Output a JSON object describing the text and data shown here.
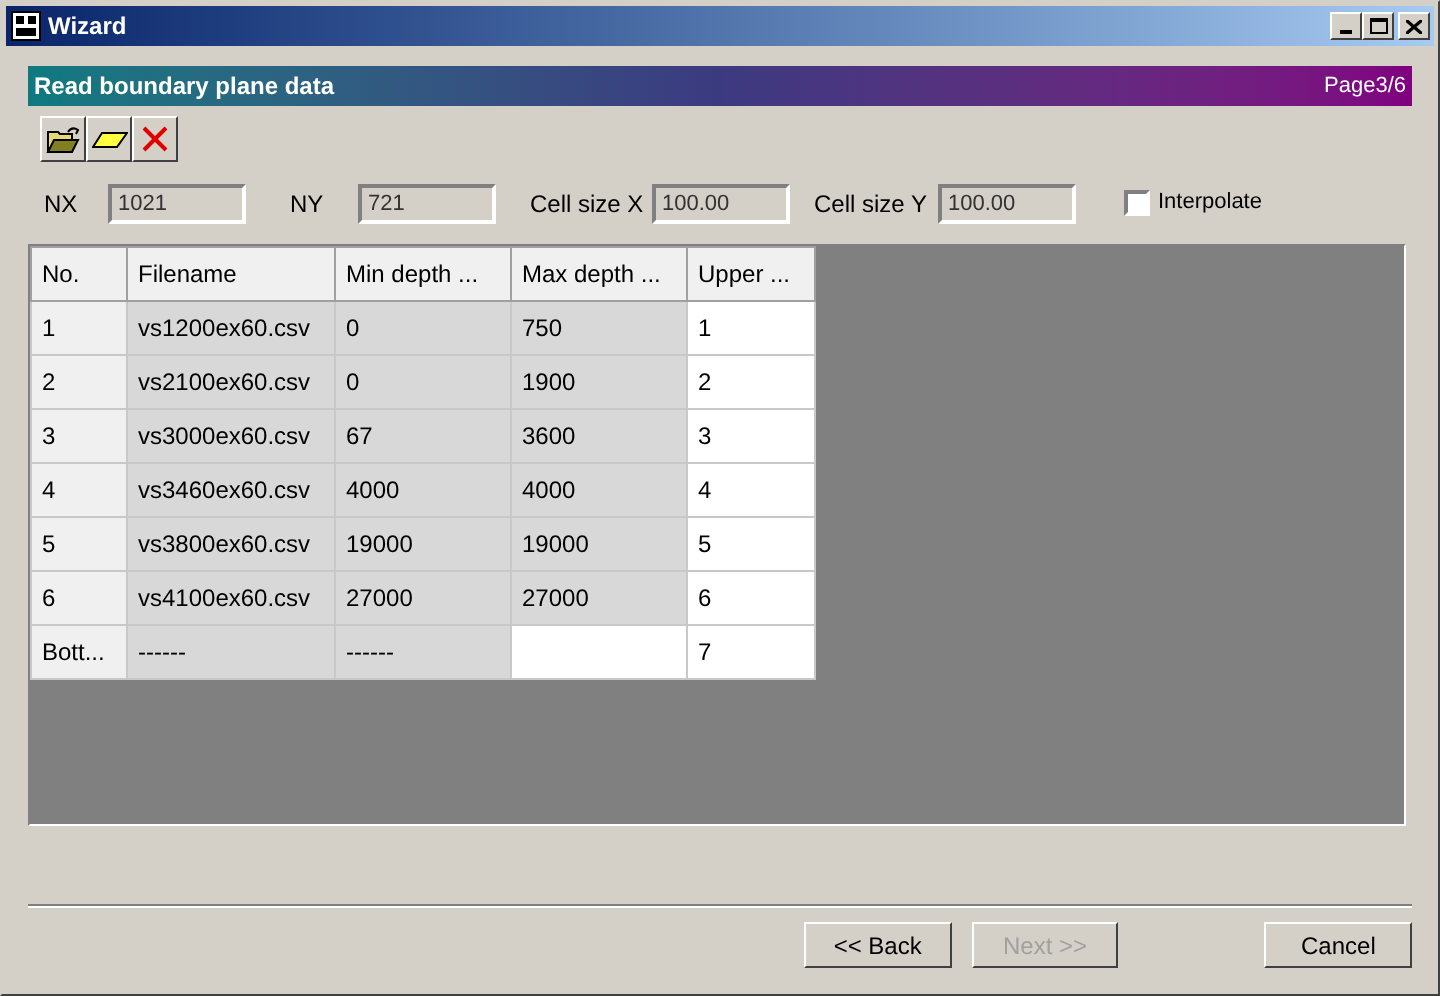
{
  "window": {
    "title": "Wizard"
  },
  "header": {
    "title": "Read boundary plane data",
    "page": "Page3/6"
  },
  "fields": [
    {
      "label": "NX",
      "value": "1021"
    },
    {
      "label": "NY",
      "value": "721"
    },
    {
      "label": "Cell size X",
      "value": "100.00"
    },
    {
      "label": "Cell size Y",
      "value": "100.00"
    }
  ],
  "interpolate": {
    "label": "Interpolate",
    "checked": false
  },
  "table": {
    "columns": [
      "No.",
      "Filename",
      "Min depth ...",
      "Max depth ...",
      "Upper ..."
    ],
    "rows": [
      [
        {
          "text": "1"
        },
        {
          "text": "vs1200ex60.csv",
          "editable": false
        },
        {
          "text": "0",
          "editable": false
        },
        {
          "text": "750",
          "editable": false
        },
        {
          "text": "1",
          "editable": true
        }
      ],
      [
        {
          "text": "2"
        },
        {
          "text": "vs2100ex60.csv",
          "editable": false
        },
        {
          "text": "0",
          "editable": false
        },
        {
          "text": "1900",
          "editable": false
        },
        {
          "text": "2",
          "editable": true
        }
      ],
      [
        {
          "text": "3"
        },
        {
          "text": "vs3000ex60.csv",
          "editable": false
        },
        {
          "text": "67",
          "editable": false
        },
        {
          "text": "3600",
          "editable": false
        },
        {
          "text": "3",
          "editable": true
        }
      ],
      [
        {
          "text": "4"
        },
        {
          "text": "vs3460ex60.csv",
          "editable": false
        },
        {
          "text": "4000",
          "editable": false
        },
        {
          "text": "4000",
          "editable": false
        },
        {
          "text": "4",
          "editable": true
        }
      ],
      [
        {
          "text": "5"
        },
        {
          "text": "vs3800ex60.csv",
          "editable": false
        },
        {
          "text": "19000",
          "editable": false
        },
        {
          "text": "19000",
          "editable": false
        },
        {
          "text": "5",
          "editable": true
        }
      ],
      [
        {
          "text": "6"
        },
        {
          "text": "vs4100ex60.csv",
          "editable": false
        },
        {
          "text": "27000",
          "editable": false
        },
        {
          "text": "27000",
          "editable": false
        },
        {
          "text": "6",
          "editable": true
        }
      ],
      [
        {
          "text": "Bott..."
        },
        {
          "text": "------",
          "editable": false
        },
        {
          "text": "------",
          "editable": false
        },
        {
          "editable": true
        },
        {
          "text": "7",
          "editable": true
        }
      ]
    ]
  },
  "buttons": [
    {
      "label": "<< Back",
      "disabled": false
    },
    {
      "label": "Next >>",
      "disabled": true
    },
    {
      "label": "Cancel",
      "disabled": false
    }
  ]
}
